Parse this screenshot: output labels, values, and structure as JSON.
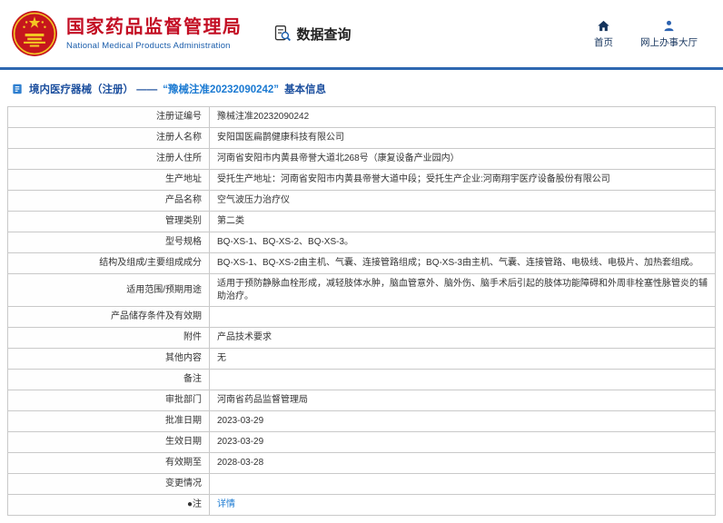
{
  "header": {
    "org_name_cn": "国家药品监督管理局",
    "org_name_en": "National Medical Products Administration",
    "section_title": "数据查询",
    "nav": {
      "home": "首页",
      "service_hall": "网上办事大厅"
    }
  },
  "breadcrumb": {
    "prefix": "境内医疗器械（注册） —— ",
    "highlight": "“豫械注准20232090242”",
    "suffix": " 基本信息"
  },
  "colors": {
    "brand_red": "#c30d23",
    "brand_blue": "#1a5dab",
    "divider_blue": "#2e68b1",
    "link_blue": "#1b7ad2"
  },
  "table": {
    "rows": [
      {
        "label": "注册证编号",
        "value": "豫械注准20232090242"
      },
      {
        "label": "注册人名称",
        "value": "安阳国医扁鹊健康科技有限公司"
      },
      {
        "label": "注册人住所",
        "value": "河南省安阳市内黄县帝誉大道北268号（康复设备产业园内）"
      },
      {
        "label": "生产地址",
        "value": "受托生产地址：河南省安阳市内黄县帝誉大道中段；受托生产企业:河南翔宇医疗设备股份有限公司"
      },
      {
        "label": "产品名称",
        "value": "空气波压力治疗仪"
      },
      {
        "label": "管理类别",
        "value": "第二类"
      },
      {
        "label": "型号规格",
        "value": "BQ-XS-1、BQ-XS-2、BQ-XS-3。"
      },
      {
        "label": "结构及组成/主要组成成分",
        "value": "BQ-XS-1、BQ-XS-2由主机、气囊、连接管路组成；BQ-XS-3由主机、气囊、连接管路、电极线、电极片、加热套组成。"
      },
      {
        "label": "适用范围/预期用途",
        "value": "适用于预防静脉血栓形成，减轻肢体水肿，脑血管意外、脑外伤、脑手术后引起的肢体功能障碍和外周非栓塞性脉管炎的辅助治疗。"
      },
      {
        "label": "产品储存条件及有效期",
        "value": ""
      },
      {
        "label": "附件",
        "value": "产品技术要求"
      },
      {
        "label": "其他内容",
        "value": "无"
      },
      {
        "label": "备注",
        "value": ""
      },
      {
        "label": "审批部门",
        "value": "河南省药品监督管理局"
      },
      {
        "label": "批准日期",
        "value": "2023-03-29"
      },
      {
        "label": "生效日期",
        "value": "2023-03-29"
      },
      {
        "label": "有效期至",
        "value": "2028-03-28"
      },
      {
        "label": "变更情况",
        "value": ""
      },
      {
        "label": "●注",
        "value": "详情",
        "link": true
      }
    ]
  }
}
